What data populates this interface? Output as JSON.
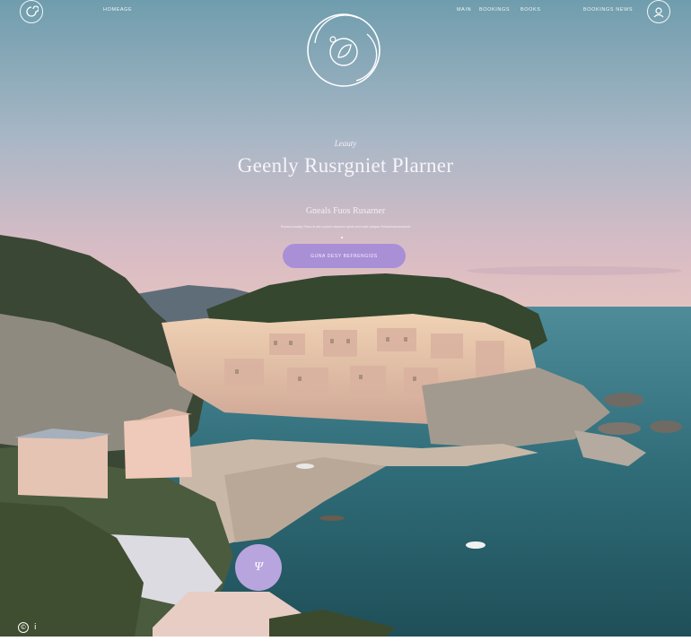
{
  "nav": {
    "left_icon": "swirl-icon",
    "left_link": "HOMEAGE",
    "links": [
      "MAIN",
      "BOOKINGS",
      "BOOKS",
      "BOOKINGS NEWS"
    ],
    "right_icon": "profile-icon"
  },
  "logo": {
    "icon": "leaf-circle-logo"
  },
  "hero": {
    "eyebrow": "Leauty",
    "title": "Geenly Rusrgniet Plarner",
    "subtitle": "Gneals Fuos Rusarner",
    "description": "Rouisd pouatly, Riaun in ant a plarnt ulasmen Iplotn annt wail intalyan Rrirsalmosmerplanel",
    "cta_label": "GUNA DESY BEFBENGIDS"
  },
  "fab": {
    "label": "Ψ"
  },
  "footer": {
    "icons": [
      "copyright-icon",
      "info-icon"
    ],
    "copyright_glyph": "©",
    "info_glyph": "i"
  },
  "colors": {
    "accent": "#a98fd6",
    "fab": "#b8a5dd",
    "sky_top": "#6f9dad",
    "sky_bottom": "#d7bcc5",
    "sea": "#2c6670"
  }
}
